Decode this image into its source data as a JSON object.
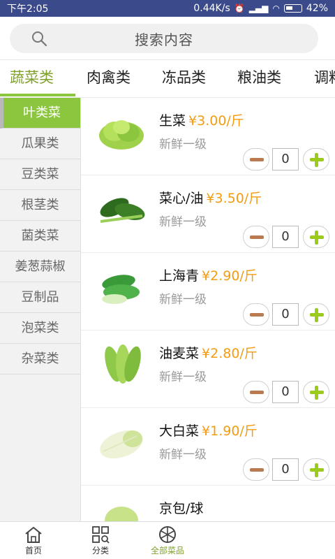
{
  "status_bar": {
    "time": "下午2:05",
    "network_speed": "0.44K/s",
    "battery": "42%"
  },
  "search": {
    "placeholder": "搜索内容"
  },
  "category_tabs": [
    {
      "label": "蔬菜类",
      "active": true
    },
    {
      "label": "肉禽类",
      "active": false
    },
    {
      "label": "冻品类",
      "active": false
    },
    {
      "label": "粮油类",
      "active": false
    },
    {
      "label": "调料",
      "active": false
    }
  ],
  "sidebar": {
    "items": [
      {
        "label": "叶类菜",
        "active": true
      },
      {
        "label": "瓜果类",
        "active": false
      },
      {
        "label": "豆类菜",
        "active": false
      },
      {
        "label": "根茎类",
        "active": false
      },
      {
        "label": "菌类菜",
        "active": false
      },
      {
        "label": "姜葱蒜椒",
        "active": false
      },
      {
        "label": "豆制品",
        "active": false
      },
      {
        "label": "泡菜类",
        "active": false
      },
      {
        "label": "杂菜类",
        "active": false
      }
    ]
  },
  "products": [
    {
      "name": "生菜",
      "price": "¥3.00/斤",
      "grade": "新鲜一级",
      "qty": "0",
      "image": "lettuce-image"
    },
    {
      "name": "菜心/油",
      "price": "¥3.50/斤",
      "grade": "新鲜一级",
      "qty": "0",
      "image": "choy-sum-image"
    },
    {
      "name": "上海青",
      "price": "¥2.90/斤",
      "grade": "新鲜一级",
      "qty": "0",
      "image": "shanghai-bok-choy-image"
    },
    {
      "name": "油麦菜",
      "price": "¥2.80/斤",
      "grade": "新鲜一级",
      "qty": "0",
      "image": "indian-lettuce-image"
    },
    {
      "name": "大白菜",
      "price": "¥1.90/斤",
      "grade": "新鲜一级",
      "qty": "0",
      "image": "napa-cabbage-image"
    },
    {
      "name": "京包/球",
      "price": "",
      "grade": "",
      "qty": "",
      "image": "cabbage-image"
    }
  ],
  "bottom_nav": [
    {
      "label": "首页",
      "icon": "home-icon",
      "active": false
    },
    {
      "label": "分类",
      "icon": "category-icon",
      "active": false
    },
    {
      "label": "全部菜品",
      "icon": "all-dishes-icon",
      "active": true
    }
  ],
  "colors": {
    "accent_green": "#8cc63f",
    "price_orange": "#f39c12",
    "status_bar": "#3b4a8a"
  }
}
